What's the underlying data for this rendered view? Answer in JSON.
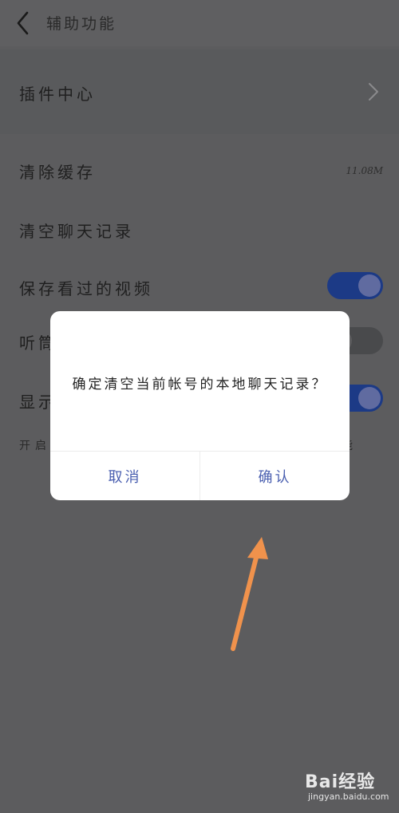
{
  "header": {
    "title": "辅助功能"
  },
  "plugin_center": {
    "label": "插件中心"
  },
  "settings": {
    "clear_cache": {
      "label": "清除缓存",
      "size": "11.08M"
    },
    "clear_chat": {
      "label": "清空聊天记录"
    },
    "save_videos": {
      "label": "保存看过的视频",
      "enabled": true
    },
    "earpiece": {
      "label_visible": "听筒",
      "enabled": false
    },
    "display": {
      "label_visible": "显示",
      "enabled": true
    },
    "hint": {
      "left_visible": "开启",
      "right_visible": "能"
    }
  },
  "dialog": {
    "message": "确定清空当前帐号的本地聊天记录？",
    "cancel_label": "取消",
    "confirm_label": "确认"
  },
  "watermark": {
    "logo": "Bai经验",
    "url": "jingyan.baidu.com"
  },
  "colors": {
    "accent": "#4a5fb0",
    "toggle_on": "#1c3a86",
    "arrow": "#f0924c"
  }
}
